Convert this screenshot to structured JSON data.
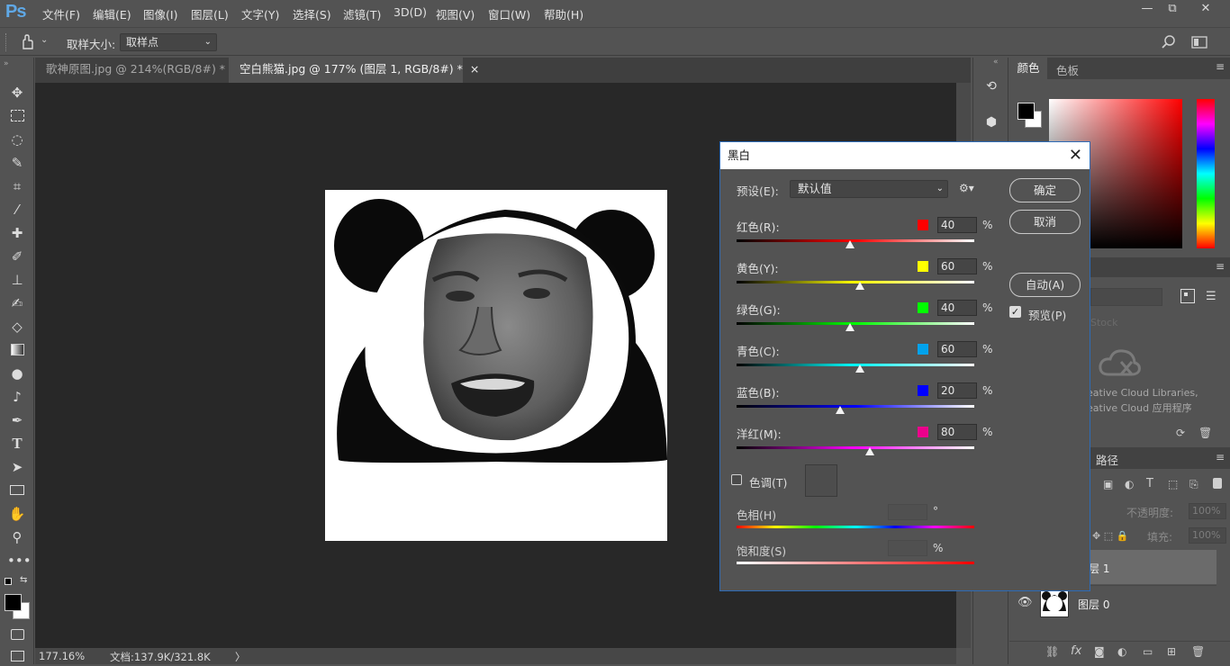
{
  "app": {
    "logo": "Ps",
    "menu": [
      "文件(F)",
      "编辑(E)",
      "图像(I)",
      "图层(L)",
      "文字(Y)",
      "选择(S)",
      "滤镜(T)",
      "3D(D)",
      "视图(V)",
      "窗口(W)",
      "帮助(H)"
    ],
    "window_controls": {
      "minimize": "—",
      "restore": "⧉",
      "close": "✕"
    }
  },
  "options_bar": {
    "sample_size_label": "取样大小:",
    "sample_size_value": "取样点"
  },
  "tabs": [
    {
      "label": "歌神原图.jpg @ 214%(RGB/8#) *",
      "active": false
    },
    {
      "label": "空白熊猫.jpg @ 177% (图层 1, RGB/8#) *",
      "active": true
    }
  ],
  "tab_close": "×",
  "status": {
    "zoom": "177.16%",
    "doc": "文档:137.9K/321.8K",
    "arrow": "〉"
  },
  "right_panel": {
    "color_tab": "颜色",
    "swatches_tab": "色板",
    "libraries_text_1": "eative Cloud Libraries,",
    "libraries_text_2": "eative Cloud 应用程序",
    "libraries_search": "Stock",
    "paths_tab": "路径",
    "opacity_label": "不透明度:",
    "opacity_value": "100%",
    "fill_label": "填充:",
    "fill_value": "100%",
    "layers": [
      {
        "name": "层 1",
        "selected": true
      },
      {
        "name": "图层 0",
        "selected": false
      }
    ]
  },
  "dialog": {
    "title": "黑白",
    "close": "✕",
    "preset_label": "预设(E):",
    "preset_value": "默认值",
    "ok": "确定",
    "cancel": "取消",
    "auto": "自动(A)",
    "preview_label": "预览(P)",
    "preview_checked": true,
    "pct": "%",
    "sliders": [
      {
        "label": "红色(R):",
        "value": "40",
        "fraction": 0.476,
        "swatch": "#ff0000",
        "gradient": [
          "#000000",
          "#ff0000",
          "#ffffff"
        ]
      },
      {
        "label": "黄色(Y):",
        "value": "60",
        "fraction": 0.518,
        "swatch": "#ffff00",
        "gradient": [
          "#000000",
          "#ffff00",
          "#ffffff"
        ]
      },
      {
        "label": "绿色(G):",
        "value": "40",
        "fraction": 0.476,
        "swatch": "#00ff00",
        "gradient": [
          "#000000",
          "#00ff00",
          "#ffffff"
        ]
      },
      {
        "label": "青色(C):",
        "value": "60",
        "fraction": 0.518,
        "swatch": "#00a2ec",
        "gradient": [
          "#000000",
          "#00ffff",
          "#ffffff"
        ]
      },
      {
        "label": "蓝色(B):",
        "value": "20",
        "fraction": 0.435,
        "swatch": "#0000ff",
        "gradient": [
          "#000000",
          "#0000ff",
          "#ffffff"
        ]
      },
      {
        "label": "洋红(M):",
        "value": "80",
        "fraction": 0.559,
        "swatch": "#ec008c",
        "gradient": [
          "#000000",
          "#ff00ff",
          "#ffffff"
        ]
      }
    ],
    "tint_label": "色调(T)",
    "tint_checked": false,
    "hue_label": "色相(H)",
    "hue_unit": "°",
    "saturation_label": "饱和度(S)",
    "saturation_unit": "%"
  }
}
